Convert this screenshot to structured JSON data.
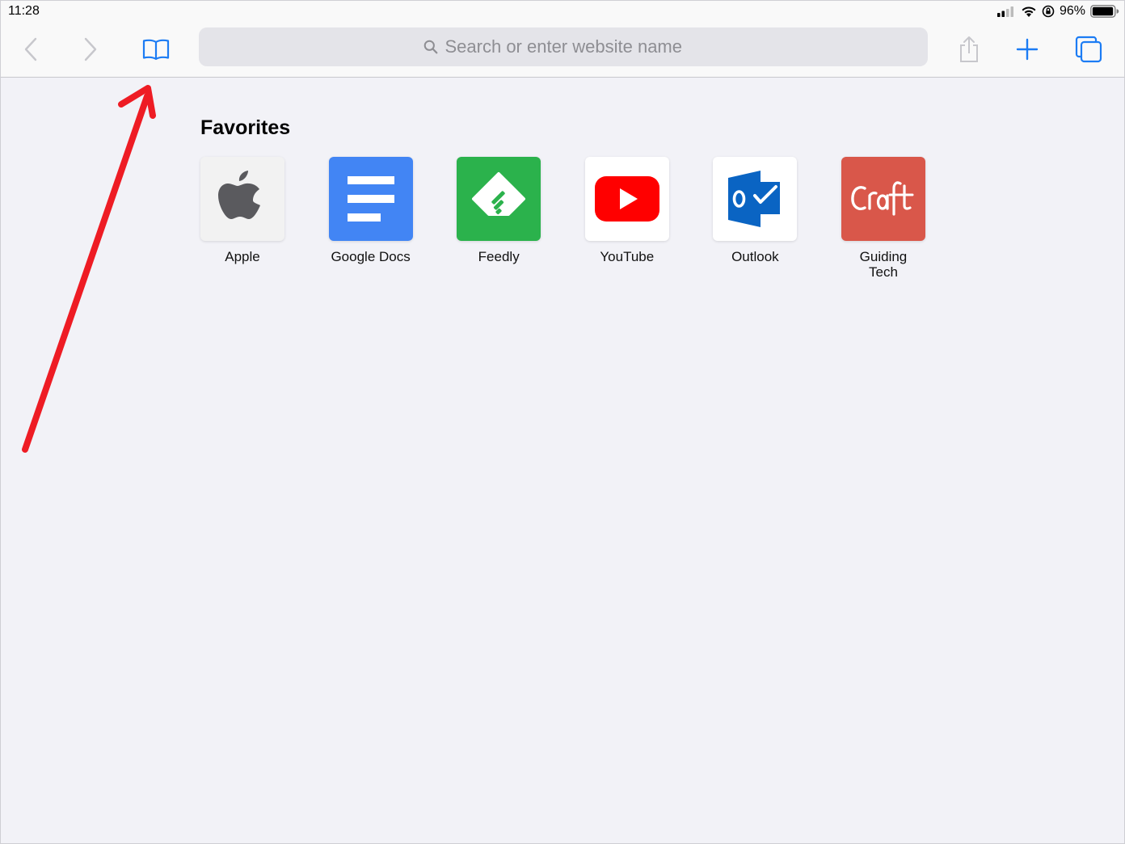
{
  "status_bar": {
    "time": "11:28",
    "battery_percent": "96%"
  },
  "toolbar": {
    "search_placeholder": "Search or enter website name",
    "icons": [
      "back-chevron-icon",
      "forward-chevron-icon",
      "bookmarks-book-icon",
      "search-icon",
      "share-icon",
      "plus-icon",
      "tabs-icon"
    ]
  },
  "favorites": {
    "title": "Favorites",
    "items": [
      {
        "label": "Apple",
        "tile_color": "#f2f2f2",
        "icon": "apple-logo-icon"
      },
      {
        "label": "Google Docs",
        "tile_color": "#4285f4",
        "icon": "google-docs-icon"
      },
      {
        "label": "Feedly",
        "tile_color": "#2bb24c",
        "icon": "feedly-icon"
      },
      {
        "label": "YouTube",
        "tile_color": "#ffffff",
        "icon": "youtube-play-icon"
      },
      {
        "label": "Outlook",
        "tile_color": "#ffffff",
        "icon": "outlook-icon"
      },
      {
        "label": "Guiding\nTech",
        "tile_color": "#d9574a",
        "icon": "craft-logo-icon"
      }
    ]
  },
  "colors": {
    "accent": "#1c7cf4",
    "annotation_arrow": "#ee1c24"
  }
}
